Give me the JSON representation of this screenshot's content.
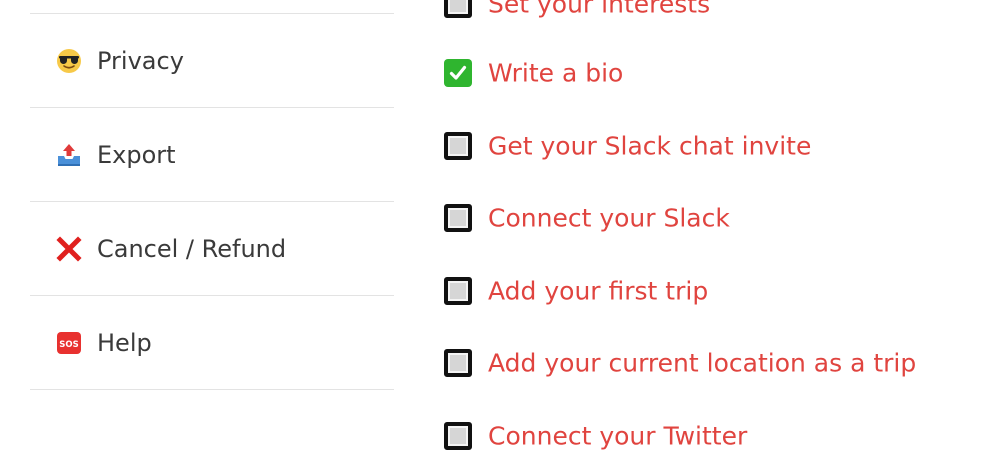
{
  "menu": {
    "items": [
      {
        "label": "Privacy",
        "icon": "sunglasses-face-icon"
      },
      {
        "label": "Export",
        "icon": "outbox-tray-icon"
      },
      {
        "label": "Cancel / Refund",
        "icon": "cross-mark-icon"
      },
      {
        "label": "Help",
        "icon": "sos-icon",
        "icon_text": "SOS"
      }
    ]
  },
  "checklist": {
    "items": [
      {
        "label": "Set your interests",
        "checked": false
      },
      {
        "label": "Write a bio",
        "checked": true
      },
      {
        "label": "Get your Slack chat invite",
        "checked": false
      },
      {
        "label": "Connect your Slack",
        "checked": false
      },
      {
        "label": "Add your first trip",
        "checked": false
      },
      {
        "label": "Add your current location as a trip",
        "checked": false
      },
      {
        "label": "Connect your Twitter",
        "checked": false
      }
    ]
  },
  "colors": {
    "link": "#e0443f",
    "menu_text": "#3a3a3a",
    "divider": "#e3e3e3",
    "check_green": "#2fb52f"
  }
}
